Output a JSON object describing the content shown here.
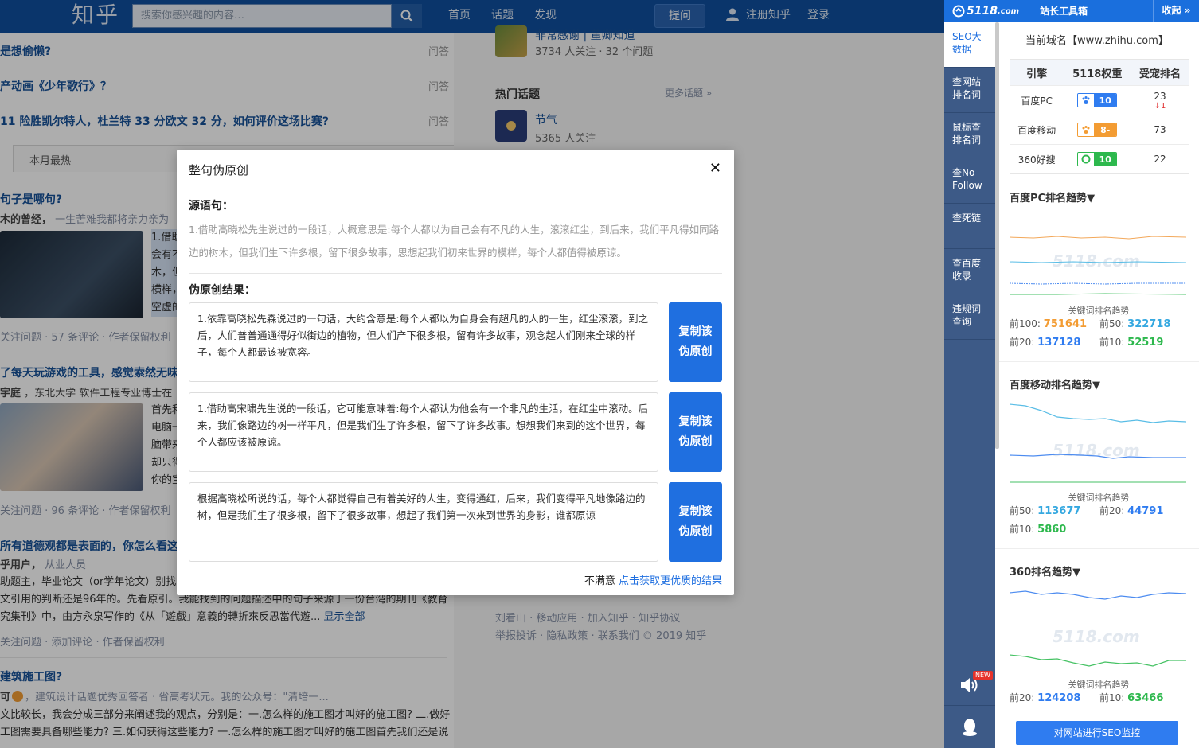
{
  "header": {
    "logo": "知乎",
    "search_placeholder": "搜索你感兴趣的内容…",
    "nav": [
      "首页",
      "话题",
      "发现"
    ],
    "ask_label": "提问",
    "register_label": "注册知乎",
    "login_label": "登录"
  },
  "feed": {
    "question_rows": [
      {
        "title": "是想偷懒?",
        "type": "问答"
      },
      {
        "title": "产动画《少年歌行》？",
        "type": "问答"
      },
      {
        "title": "11 险胜凯尔特人，杜兰特 33 分欧文 32 分，如何评价这场比赛?",
        "type": "问答"
      }
    ],
    "tab_monthly": "本月最热",
    "items": [
      {
        "title": "句子是哪句?",
        "author": "木的曾经，",
        "author_desc": "一生苦难我都将亲力亲为",
        "excerpt": "1.借助\n会有不\n木，但\n横样，\n空虚的",
        "meta": "关注问题 · 57 条评论 · 作者保留权利"
      },
      {
        "title": "了每天玩游戏的工具，感觉索然无味",
        "author": "宇庭",
        "author_desc": "，东北大学 软件工程专业博士在",
        "excerpt": "首先和\n电脑一\n脑带来\n却只得\n你的宝",
        "meta": "关注问题 · 96 条评论 · 作者保留权利"
      },
      {
        "title": "所有道德观都是表面的，你怎么看这",
        "author": "乎用户，",
        "author_desc": "从业人员",
        "body": [
          "助题主，毕业论文（or学年论文）别找错",
          "文引用的判断还是96年的。先看原引。我能找到的问题描述中的句子来源于一份台湾的期刊《教育",
          "究集刊》中，由方永泉写作的《从「遊戲」意義的轉折來反思當代遊..."
        ],
        "show_all": "显示全部",
        "meta": "关注问题 · 添加评论 · 作者保留权利"
      },
      {
        "title": "建筑施工图?",
        "author": "可",
        "author_desc": "，建筑设计话题优秀回答者 · 省高考状元。我的公众号：\"清培一...",
        "body": [
          "文比较长，我会分成三部分来阐述我的观点，分别是：一.怎么样的施工图才叫好的施工图? 二.做好",
          "工图需要具备哪些能力? 三.如何获得这些能力? 一.怎么样的施工图才叫好的施工图首先我们还是说"
        ]
      }
    ]
  },
  "right": {
    "top_topic": {
      "name": "非常感谢 | 董卿知道",
      "meta": "3734 人关注 · 32 个问题"
    },
    "hot_topics_label": "热门话题",
    "more_topics_label": "更多话题 »",
    "topic": {
      "name": "节气",
      "meta": "5365 人关注"
    },
    "footer_line1": "刘看山 · 移动应用 · 加入知乎 · 知乎协议",
    "footer_line2": "举报投诉 · 隐私政策 · 联系我们 © 2019 知乎"
  },
  "modal": {
    "title": "整句伪原创",
    "close_symbol": "✕",
    "source_label": "源语句：",
    "source_text": "1.借助高晓松先生说过的一段话，大概意思是:每个人都以为自己会有不凡的人生，滚滚红尘，到后来，我们平凡得如同路边的树木，但我们生下许多根，留下很多故事，思想起我们初来世界的模样，每个人都值得被原谅。",
    "result_label": "伪原创结果：",
    "results": [
      "1.依靠高晓松先森说过的一句话，大约含意是:每个人都以为自身会有超凡的人的一生，红尘滚滚，到之后，人们普普通通得好似街边的植物，但人们产下很多根，留有许多故事，观念起人们刚来全球的样子，每个人都最该被宽容。",
      "1.借助高宋啸先生说的一段话，它可能意味着:每个人都认为他会有一个非凡的生活，在红尘中滚动。后来，我们像路边的树一样平凡，但是我们生了许多根，留下了许多故事。想想我们来到的这个世界，每个人都应该被原谅。",
      "根据高晓松所说的话，每个人都觉得自己有着美好的人生，变得通红，后来，我们变得平凡地像路边的树，但是我们生了很多根，留下了很多故事，想起了我们第一次来到世界的身影，谁都原谅"
    ],
    "copy_label": "复制该\n伪原创",
    "not_satisfied": "不满意",
    "get_better": "点击获取更优质的结果"
  },
  "seo": {
    "logo_text": "5118",
    "logo_suffix": ".com",
    "toolbox_title": "站长工具箱",
    "collapse_label": "收起 »",
    "nav_items": [
      "SEO大\n数据",
      "查网站\n排名词",
      "鼠标查\n排名词",
      "查No\nFollow",
      "查死链",
      "查百度\n收录",
      "违规词\n查询"
    ],
    "new_badge": "NEW",
    "domain": "当前域名【www.zhihu.com】",
    "table_headers": [
      "引擎",
      "5118权重",
      "受宠排名"
    ],
    "table_rows": [
      {
        "engine": "百度PC",
        "weight": "10",
        "rank": "23",
        "rank_change": "1",
        "color": "#2f7cf0"
      },
      {
        "engine": "百度移动",
        "weight": "8-",
        "rank": "73",
        "color": "#f39c33"
      },
      {
        "engine": "360好搜",
        "weight": "10",
        "rank": "22",
        "color": "#2db84d"
      }
    ],
    "trends": [
      {
        "title": "百度PC排名趋势▼",
        "caption": "关键词排名趋势",
        "stats": [
          {
            "label": "前100:",
            "value": "751641",
            "color": "#f39c33"
          },
          {
            "label": "前50:",
            "value": "322718",
            "color": "#35a8e0"
          },
          {
            "label": "前20:",
            "value": "137128",
            "color": "#2f7cf0"
          },
          {
            "label": "前10:",
            "value": "52519",
            "color": "#2db84d"
          }
        ]
      },
      {
        "title": "百度移动排名趋势▼",
        "caption": "关键词排名趋势",
        "stats": [
          {
            "label": "前50:",
            "value": "113677",
            "color": "#35a8e0"
          },
          {
            "label": "前20:",
            "value": "44791",
            "color": "#2f7cf0"
          },
          {
            "label": "前10:",
            "value": "5860",
            "color": "#2db84d"
          }
        ]
      },
      {
        "title": "360排名趋势▼",
        "caption": "关键词排名趋势",
        "stats": [
          {
            "label": "前20:",
            "value": "124208",
            "color": "#2f7cf0"
          },
          {
            "label": "前10:",
            "value": "63466",
            "color": "#2db84d"
          }
        ]
      }
    ],
    "monitor_button": "对网站进行SEO监控"
  }
}
